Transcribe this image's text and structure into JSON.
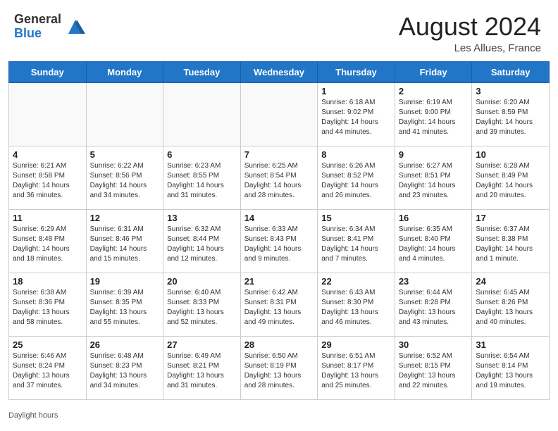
{
  "header": {
    "logo_general": "General",
    "logo_blue": "Blue",
    "month_year": "August 2024",
    "location": "Les Allues, France"
  },
  "days_of_week": [
    "Sunday",
    "Monday",
    "Tuesday",
    "Wednesday",
    "Thursday",
    "Friday",
    "Saturday"
  ],
  "weeks": [
    [
      {
        "num": "",
        "info": ""
      },
      {
        "num": "",
        "info": ""
      },
      {
        "num": "",
        "info": ""
      },
      {
        "num": "",
        "info": ""
      },
      {
        "num": "1",
        "info": "Sunrise: 6:18 AM\nSunset: 9:02 PM\nDaylight: 14 hours\nand 44 minutes."
      },
      {
        "num": "2",
        "info": "Sunrise: 6:19 AM\nSunset: 9:00 PM\nDaylight: 14 hours\nand 41 minutes."
      },
      {
        "num": "3",
        "info": "Sunrise: 6:20 AM\nSunset: 8:59 PM\nDaylight: 14 hours\nand 39 minutes."
      }
    ],
    [
      {
        "num": "4",
        "info": "Sunrise: 6:21 AM\nSunset: 8:58 PM\nDaylight: 14 hours\nand 36 minutes."
      },
      {
        "num": "5",
        "info": "Sunrise: 6:22 AM\nSunset: 8:56 PM\nDaylight: 14 hours\nand 34 minutes."
      },
      {
        "num": "6",
        "info": "Sunrise: 6:23 AM\nSunset: 8:55 PM\nDaylight: 14 hours\nand 31 minutes."
      },
      {
        "num": "7",
        "info": "Sunrise: 6:25 AM\nSunset: 8:54 PM\nDaylight: 14 hours\nand 28 minutes."
      },
      {
        "num": "8",
        "info": "Sunrise: 6:26 AM\nSunset: 8:52 PM\nDaylight: 14 hours\nand 26 minutes."
      },
      {
        "num": "9",
        "info": "Sunrise: 6:27 AM\nSunset: 8:51 PM\nDaylight: 14 hours\nand 23 minutes."
      },
      {
        "num": "10",
        "info": "Sunrise: 6:28 AM\nSunset: 8:49 PM\nDaylight: 14 hours\nand 20 minutes."
      }
    ],
    [
      {
        "num": "11",
        "info": "Sunrise: 6:29 AM\nSunset: 8:48 PM\nDaylight: 14 hours\nand 18 minutes."
      },
      {
        "num": "12",
        "info": "Sunrise: 6:31 AM\nSunset: 8:46 PM\nDaylight: 14 hours\nand 15 minutes."
      },
      {
        "num": "13",
        "info": "Sunrise: 6:32 AM\nSunset: 8:44 PM\nDaylight: 14 hours\nand 12 minutes."
      },
      {
        "num": "14",
        "info": "Sunrise: 6:33 AM\nSunset: 8:43 PM\nDaylight: 14 hours\nand 9 minutes."
      },
      {
        "num": "15",
        "info": "Sunrise: 6:34 AM\nSunset: 8:41 PM\nDaylight: 14 hours\nand 7 minutes."
      },
      {
        "num": "16",
        "info": "Sunrise: 6:35 AM\nSunset: 8:40 PM\nDaylight: 14 hours\nand 4 minutes."
      },
      {
        "num": "17",
        "info": "Sunrise: 6:37 AM\nSunset: 8:38 PM\nDaylight: 14 hours\nand 1 minute."
      }
    ],
    [
      {
        "num": "18",
        "info": "Sunrise: 6:38 AM\nSunset: 8:36 PM\nDaylight: 13 hours\nand 58 minutes."
      },
      {
        "num": "19",
        "info": "Sunrise: 6:39 AM\nSunset: 8:35 PM\nDaylight: 13 hours\nand 55 minutes."
      },
      {
        "num": "20",
        "info": "Sunrise: 6:40 AM\nSunset: 8:33 PM\nDaylight: 13 hours\nand 52 minutes."
      },
      {
        "num": "21",
        "info": "Sunrise: 6:42 AM\nSunset: 8:31 PM\nDaylight: 13 hours\nand 49 minutes."
      },
      {
        "num": "22",
        "info": "Sunrise: 6:43 AM\nSunset: 8:30 PM\nDaylight: 13 hours\nand 46 minutes."
      },
      {
        "num": "23",
        "info": "Sunrise: 6:44 AM\nSunset: 8:28 PM\nDaylight: 13 hours\nand 43 minutes."
      },
      {
        "num": "24",
        "info": "Sunrise: 6:45 AM\nSunset: 8:26 PM\nDaylight: 13 hours\nand 40 minutes."
      }
    ],
    [
      {
        "num": "25",
        "info": "Sunrise: 6:46 AM\nSunset: 8:24 PM\nDaylight: 13 hours\nand 37 minutes."
      },
      {
        "num": "26",
        "info": "Sunrise: 6:48 AM\nSunset: 8:23 PM\nDaylight: 13 hours\nand 34 minutes."
      },
      {
        "num": "27",
        "info": "Sunrise: 6:49 AM\nSunset: 8:21 PM\nDaylight: 13 hours\nand 31 minutes."
      },
      {
        "num": "28",
        "info": "Sunrise: 6:50 AM\nSunset: 8:19 PM\nDaylight: 13 hours\nand 28 minutes."
      },
      {
        "num": "29",
        "info": "Sunrise: 6:51 AM\nSunset: 8:17 PM\nDaylight: 13 hours\nand 25 minutes."
      },
      {
        "num": "30",
        "info": "Sunrise: 6:52 AM\nSunset: 8:15 PM\nDaylight: 13 hours\nand 22 minutes."
      },
      {
        "num": "31",
        "info": "Sunrise: 6:54 AM\nSunset: 8:14 PM\nDaylight: 13 hours\nand 19 minutes."
      }
    ]
  ],
  "footer": {
    "daylight_label": "Daylight hours"
  }
}
